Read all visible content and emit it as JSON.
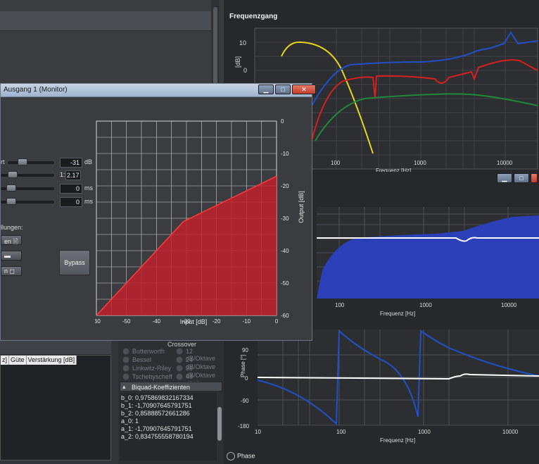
{
  "freq_panel": {
    "title": "Frequenzgang",
    "y_ticks": [
      "10",
      "0"
    ],
    "ylabel": "[dB]",
    "x_ticks": [
      "100",
      "1000",
      "10000"
    ],
    "xlabel": "Frequenz [Hz]",
    "series_colors": {
      "blue": "#2050c8",
      "yellow": "#e6d61a",
      "red": "#d62020",
      "green": "#1f8a3c"
    }
  },
  "dialog": {
    "title": "Ausgang 1 (Monitor)",
    "params": [
      {
        "label": "rt",
        "value": "-31",
        "unit": "dB"
      },
      {
        "label": "",
        "value": "2.17",
        "prefix": "1:",
        "unit": ""
      },
      {
        "label": "",
        "value": "0",
        "unit": "ms"
      },
      {
        "label": "",
        "value": "0",
        "unit": "ms"
      }
    ],
    "settings_label": "llungen:",
    "btn1": "en",
    "btn2": "",
    "btn3": "n",
    "bypass": "Bypass"
  },
  "chart_data": [
    {
      "type": "area",
      "title": "",
      "xlabel": "Input [dB]",
      "ylabel": "Output [dB]",
      "xlim": [
        -60,
        0
      ],
      "ylim": [
        -60,
        0
      ],
      "x_ticks": [
        -60,
        -50,
        -40,
        -30,
        -20,
        -10,
        0
      ],
      "y_ticks": [
        0,
        -10,
        -20,
        -30,
        -40,
        -50,
        -60
      ],
      "x": [
        -60,
        -31,
        0
      ],
      "values": [
        -60,
        -31,
        -17
      ],
      "color": "#c0202e"
    }
  ],
  "mag_panel": {
    "x_ticks": [
      "100",
      "1000",
      "10000"
    ],
    "xlabel": "Frequenz [Hz]"
  },
  "phase_panel": {
    "y_ticks": [
      "90",
      "0",
      "-90",
      "-180"
    ],
    "ylabel": "Phase [°]",
    "x_ticks": [
      "10",
      "100",
      "1000",
      "10000"
    ],
    "xlabel": "Frequenz [Hz]",
    "toggle_label": "Phase"
  },
  "eq_table": {
    "headers": [
      "z]",
      "Güte",
      "Verstärkung [dB]"
    ]
  },
  "crossover": {
    "title": "Crossover",
    "types": [
      "Butterworth",
      "Bessel",
      "Linkwitz-Riley",
      "Tschebyscheff"
    ],
    "slopes": [
      "12 dB/Oktave",
      "24 dB/Oktave",
      "36 dB/Oktave",
      "48 dB/Oktave"
    ],
    "biquad_title": "Biquad-Koeffizienten",
    "coefficients": [
      "b_0: 0,975869832167334",
      "b_1: -1,70907645791751",
      "b_2: 0,85888572661286",
      "a_0: 1",
      "a_1: -1,70907645791751",
      "a_2: 0,834755558780194"
    ]
  }
}
